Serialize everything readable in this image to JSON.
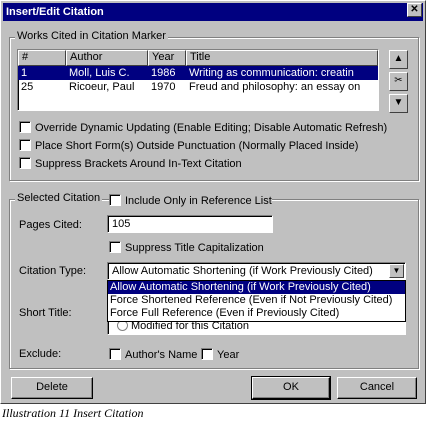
{
  "dialog": {
    "title": "Insert/Edit Citation",
    "close_glyph": "✕"
  },
  "works_cited": {
    "group_label": "Works Cited in Citation Marker",
    "columns": [
      "#",
      "Author",
      "Year",
      "Title"
    ],
    "rows": [
      {
        "num": "1",
        "author": "Moll, Luis C.",
        "year": "1986",
        "title": "Writing as communication: creatin",
        "selected": true
      },
      {
        "num": "25",
        "author": "Ricoeur, Paul",
        "year": "1970",
        "title": "Freud and philosophy: an essay on",
        "selected": false
      }
    ],
    "side_buttons": [
      {
        "icon": "move-up-icon",
        "glyph": "▲"
      },
      {
        "icon": "cut-scissors-icon",
        "glyph": "✂"
      },
      {
        "icon": "move-down-icon",
        "glyph": "▼"
      }
    ]
  },
  "options": {
    "override_updating": "Override Dynamic Updating (Enable Editing; Disable Automatic Refresh)",
    "place_short_form": "Place Short Form(s) Outside Punctuation (Normally Placed Inside)",
    "suppress_brackets": "Suppress Brackets Around In-Text Citation"
  },
  "selected_citation": {
    "group_label": "Selected Citation",
    "include_only_reference": "Include Only in Reference List",
    "pages_cited_label": "Pages Cited:",
    "pages_cited_value": "105",
    "suppress_title_cap": "Suppress Title Capitalization",
    "citation_type_label": "Citation Type:",
    "citation_type_value": "Allow Automatic Shortening (if Work Previously Cited)",
    "citation_type_options": [
      "Allow Automatic Shortening (if Work Previously Cited)",
      "Force Shortened Reference (Even if Not Previously Cited)",
      "Force Full Reference (Even if Previously Cited)"
    ],
    "short_title_label": "Short Title:",
    "modified_for_citation": "Modified for this Citation",
    "exclude_label": "Exclude:",
    "authors_name": "Author's Name",
    "year": "Year"
  },
  "buttons": {
    "delete": "Delete",
    "ok": "OK",
    "cancel": "Cancel"
  },
  "caption": "Illustration 11 Insert Citation"
}
